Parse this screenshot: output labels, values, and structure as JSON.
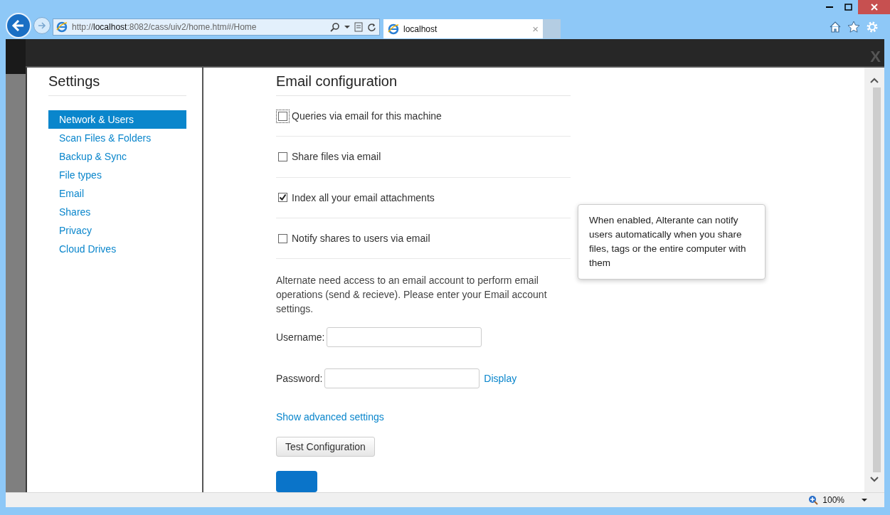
{
  "browser": {
    "address": "http://**localhost**:8082/cass/uiv2/home.htm#/Home",
    "tab_title": "localhost",
    "tab_close": "×",
    "zoom": "100%"
  },
  "dialog": {
    "close": "X"
  },
  "sidebar": {
    "title": "Settings",
    "items": [
      {
        "label": "Network & Users",
        "selected": true
      },
      {
        "label": "Scan Files & Folders",
        "selected": false
      },
      {
        "label": "Backup & Sync",
        "selected": false
      },
      {
        "label": "File types",
        "selected": false
      },
      {
        "label": "Email",
        "selected": false
      },
      {
        "label": "Shares",
        "selected": false
      },
      {
        "label": "Privacy",
        "selected": false
      },
      {
        "label": "Cloud Drives",
        "selected": false
      }
    ]
  },
  "main": {
    "title": "Email configuration",
    "options": [
      {
        "label": "Queries via email for this machine",
        "checked": false,
        "focused": true
      },
      {
        "label": "Share files via email",
        "checked": false,
        "focused": false
      },
      {
        "label": "Index all your email attachments",
        "checked": true,
        "focused": false
      },
      {
        "label": "Notify shares to users via email",
        "checked": false,
        "focused": false
      }
    ],
    "tooltip": "When enabled, Alterante can notify users automatically when you share files, tags or the entire computer with them",
    "description": "Alternate need access to an email account to perform email operations (send & recieve). Please enter your Email account settings.",
    "username_label": "Username:",
    "password_label": "Password:",
    "display_link": "Display",
    "advanced_link": "Show advanced settings",
    "test_button": "Test Configuration"
  }
}
